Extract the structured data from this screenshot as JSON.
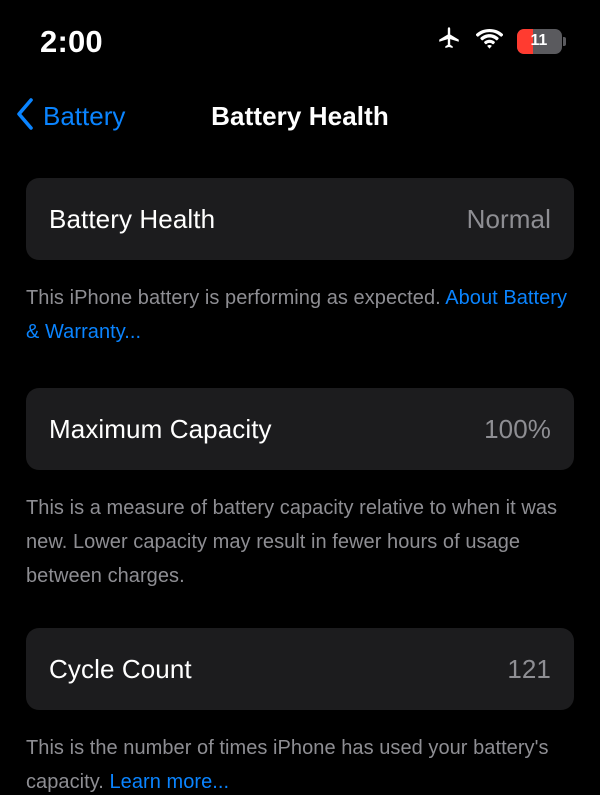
{
  "status_bar": {
    "time": "2:00",
    "airplane_icon": "airplane-mode-icon",
    "wifi_icon": "wifi-icon",
    "battery": {
      "icon": "battery-icon",
      "level_text": "11",
      "level_percent": 11,
      "low_battery_color": "#ff3b30"
    }
  },
  "nav": {
    "back_label": "Battery",
    "back_icon": "chevron-left-icon",
    "title": "Battery Health",
    "accent_color": "#0a84ff"
  },
  "sections": [
    {
      "row_label": "Battery Health",
      "row_value": "Normal",
      "footer_text": "This iPhone battery is performing as expected. ",
      "footer_link": "About Battery & Warranty...",
      "footer_tail": ""
    },
    {
      "row_label": "Maximum Capacity",
      "row_value": "100%",
      "footer_text": "This is a measure of battery capacity relative to when it was new. Lower capacity may result in fewer hours of usage between charges.",
      "footer_link": "",
      "footer_tail": ""
    },
    {
      "row_label": "Cycle Count",
      "row_value": "121",
      "footer_text": "This is the number of times iPhone has used your battery's capacity. ",
      "footer_link": "Learn more...",
      "footer_tail": ""
    }
  ],
  "theme": {
    "background": "#000000",
    "card_background": "#1c1c1e",
    "primary_text": "#ffffff",
    "secondary_text": "#8e8e93",
    "accent": "#0a84ff"
  }
}
